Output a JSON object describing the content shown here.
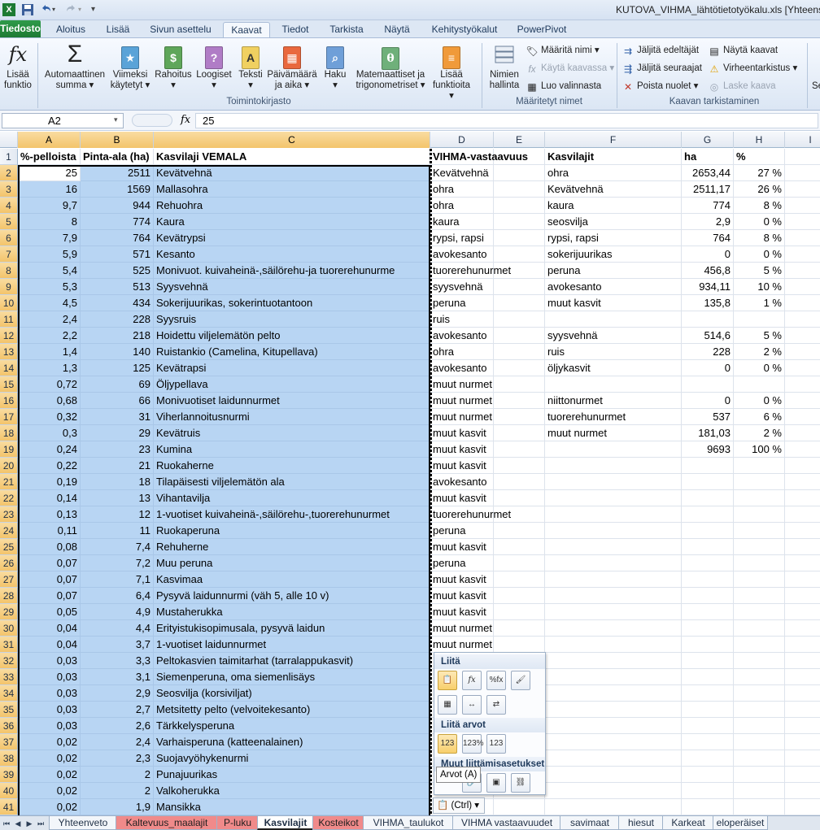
{
  "window": {
    "title": "KUTOVA_VIHMA_lähtötietotyökalu.xls [Yhteens"
  },
  "ribbon_tabs": [
    "Tiedosto",
    "Aloitus",
    "Lisää",
    "Sivun asettelu",
    "Kaavat",
    "Tiedot",
    "Tarkista",
    "Näytä",
    "Kehitystyökalut",
    "PowerPivot"
  ],
  "active_ribbon_tab": "Kaavat",
  "ribbon": {
    "insert_function": [
      "Lisää",
      "funktio"
    ],
    "autosum": [
      "Automaattinen",
      "summa ▾"
    ],
    "recent": [
      "Viimeksi",
      "käytetyt ▾"
    ],
    "financial": [
      "Rahoitus",
      "▾"
    ],
    "logical": [
      "Loogiset",
      "▾"
    ],
    "text": [
      "Teksti",
      "▾"
    ],
    "datetime": [
      "Päivämäärä",
      "ja aika ▾"
    ],
    "lookup": [
      "Haku",
      "▾"
    ],
    "math": [
      "Matemaattiset ja",
      "trigonometriset ▾"
    ],
    "more": [
      "Lisää",
      "funktioita ▾"
    ],
    "library_group": "Toimintokirjasto",
    "name_manager": [
      "Nimien",
      "hallinta"
    ],
    "define_name": "Määritä nimi ▾",
    "use_in_formula": "Käytä kaavassa ▾",
    "create_from_selection": "Luo valinnasta",
    "names_group": "Määritetyt nimet",
    "trace_precedents": "Jäljitä edeltäjät",
    "trace_dependents": "Jäljitä seuraajat",
    "remove_arrows": "Poista nuolet ▾",
    "show_formulas": "Näytä kaavat",
    "error_checking": "Virheentarkistus ▾",
    "evaluate_formula": "Laske kaava",
    "audit_group": "Kaavan tarkistaminen",
    "cut_off": "Se"
  },
  "formula_bar": {
    "name_box": "A2",
    "fx": "fx",
    "value": "25"
  },
  "columns": [
    "A",
    "B",
    "C",
    "D",
    "E",
    "F",
    "G",
    "H",
    "I"
  ],
  "header_row": {
    "a": "%-pelloista",
    "b": "Pinta-ala (ha)",
    "c": "Kasvilaji VEMALA",
    "d": "VIHMA-vastaavuus",
    "f": "Kasvilajit",
    "g": "ha",
    "h": "%"
  },
  "rows": [
    {
      "n": "2",
      "a": "25",
      "b": "2511",
      "c": "Kevätvehnä",
      "d": "Kevätvehnä",
      "f": "ohra",
      "g": "2653,44",
      "h": "27 %"
    },
    {
      "n": "3",
      "a": "16",
      "b": "1569",
      "c": "Mallasohra",
      "d": "ohra",
      "f": "Kevätvehnä",
      "g": "2511,17",
      "h": "26 %"
    },
    {
      "n": "4",
      "a": "9,7",
      "b": "944",
      "c": "Rehuohra",
      "d": "ohra",
      "f": "kaura",
      "g": "774",
      "h": "8 %"
    },
    {
      "n": "5",
      "a": "8",
      "b": "774",
      "c": "Kaura",
      "d": "kaura",
      "f": "seosvilja",
      "g": "2,9",
      "h": "0 %"
    },
    {
      "n": "6",
      "a": "7,9",
      "b": "764",
      "c": "Kevätrypsi",
      "d": "rypsi, rapsi",
      "f": "rypsi, rapsi",
      "g": "764",
      "h": "8 %"
    },
    {
      "n": "7",
      "a": "5,9",
      "b": "571",
      "c": "Kesanto",
      "d": "avokesanto",
      "f": "sokerijuurikas",
      "g": "0",
      "h": "0 %"
    },
    {
      "n": "8",
      "a": "5,4",
      "b": "525",
      "c": "Monivuot. kuivaheinä-,säilörehu-ja tuorerehunurme",
      "d": "tuorerehunurmet",
      "f": "peruna",
      "g": "456,8",
      "h": "5 %"
    },
    {
      "n": "9",
      "a": "5,3",
      "b": "513",
      "c": "Syysvehnä",
      "d": "syysvehnä",
      "f": "avokesanto",
      "g": "934,11",
      "h": "10 %"
    },
    {
      "n": "10",
      "a": "4,5",
      "b": "434",
      "c": "Sokerijuurikas, sokerintuotantoon",
      "d": "peruna",
      "f": "muut kasvit",
      "g": "135,8",
      "h": "1 %"
    },
    {
      "n": "11",
      "a": "2,4",
      "b": "228",
      "c": "Syysruis",
      "d": "ruis",
      "f": "",
      "g": "",
      "h": ""
    },
    {
      "n": "12",
      "a": "2,2",
      "b": "218",
      "c": "Hoidettu viljelemätön pelto",
      "d": "avokesanto",
      "f": "syysvehnä",
      "g": "514,6",
      "h": "5 %"
    },
    {
      "n": "13",
      "a": "1,4",
      "b": "140",
      "c": "Ruistankio (Camelina, Kitupellava)",
      "d": "ohra",
      "f": "ruis",
      "g": "228",
      "h": "2 %"
    },
    {
      "n": "14",
      "a": "1,3",
      "b": "125",
      "c": "Kevätrapsi",
      "d": "avokesanto",
      "f": "öljykasvit",
      "g": "0",
      "h": "0 %"
    },
    {
      "n": "15",
      "a": "0,72",
      "b": "69",
      "c": "Öljypellava",
      "d": "muut nurmet",
      "f": "",
      "g": "",
      "h": ""
    },
    {
      "n": "16",
      "a": "0,68",
      "b": "66",
      "c": "Monivuotiset laidunnurmet",
      "d": "muut nurmet",
      "f": "niittonurmet",
      "g": "0",
      "h": "0 %"
    },
    {
      "n": "17",
      "a": "0,32",
      "b": "31",
      "c": "Viherlannoitusnurmi",
      "d": "muut nurmet",
      "f": "tuorerehunurmet",
      "g": "537",
      "h": "6 %"
    },
    {
      "n": "18",
      "a": "0,3",
      "b": "29",
      "c": "Kevätruis",
      "d": "muut kasvit",
      "f": "muut nurmet",
      "g": "181,03",
      "h": "2 %"
    },
    {
      "n": "19",
      "a": "0,24",
      "b": "23",
      "c": "Kumina",
      "d": "muut kasvit",
      "f": "",
      "g": "9693",
      "h": "100 %"
    },
    {
      "n": "20",
      "a": "0,22",
      "b": "21",
      "c": "Ruokaherne",
      "d": "muut kasvit",
      "f": "",
      "g": "",
      "h": ""
    },
    {
      "n": "21",
      "a": "0,19",
      "b": "18",
      "c": "Tilapäisesti viljelemätön ala",
      "d": "avokesanto",
      "f": "",
      "g": "",
      "h": ""
    },
    {
      "n": "22",
      "a": "0,14",
      "b": "13",
      "c": "Vihantavilja",
      "d": "muut kasvit",
      "f": "",
      "g": "",
      "h": ""
    },
    {
      "n": "23",
      "a": "0,13",
      "b": "12",
      "c": "1-vuotiset kuivaheinä-,säilörehu-,tuorerehunurmet",
      "d": "tuorerehunurmet",
      "f": "",
      "g": "",
      "h": ""
    },
    {
      "n": "24",
      "a": "0,11",
      "b": "11",
      "c": "Ruokaperuna",
      "d": "peruna",
      "f": "",
      "g": "",
      "h": ""
    },
    {
      "n": "25",
      "a": "0,08",
      "b": "7,4",
      "c": "Rehuherne",
      "d": "muut kasvit",
      "f": "",
      "g": "",
      "h": ""
    },
    {
      "n": "26",
      "a": "0,07",
      "b": "7,2",
      "c": "Muu peruna",
      "d": "peruna",
      "f": "",
      "g": "",
      "h": ""
    },
    {
      "n": "27",
      "a": "0,07",
      "b": "7,1",
      "c": "Kasvimaa",
      "d": "muut kasvit",
      "f": "",
      "g": "",
      "h": ""
    },
    {
      "n": "28",
      "a": "0,07",
      "b": "6,4",
      "c": "Pysyvä laidunnurmi (väh 5, alle 10 v)",
      "d": "muut kasvit",
      "f": "",
      "g": "",
      "h": ""
    },
    {
      "n": "29",
      "a": "0,05",
      "b": "4,9",
      "c": "Mustaherukka",
      "d": "muut kasvit",
      "f": "",
      "g": "",
      "h": ""
    },
    {
      "n": "30",
      "a": "0,04",
      "b": "4,4",
      "c": "Erityistukisopimusala, pysyvä laidun",
      "d": "muut nurmet",
      "f": "",
      "g": "",
      "h": ""
    },
    {
      "n": "31",
      "a": "0,04",
      "b": "3,7",
      "c": "1-vuotiset laidunnurmet",
      "d": "muut nurmet",
      "f": "",
      "g": "",
      "h": ""
    },
    {
      "n": "32",
      "a": "0,03",
      "b": "3,3",
      "c": "Peltokasvien taimitarhat (tarralappukasvit)",
      "d": "",
      "f": "",
      "g": "",
      "h": ""
    },
    {
      "n": "33",
      "a": "0,03",
      "b": "3,1",
      "c": "Siemenperuna, oma siemenlisäys",
      "d": "",
      "f": "",
      "g": "",
      "h": ""
    },
    {
      "n": "34",
      "a": "0,03",
      "b": "2,9",
      "c": "Seosvilja (korsiviljat)",
      "d": "",
      "f": "",
      "g": "",
      "h": ""
    },
    {
      "n": "35",
      "a": "0,03",
      "b": "2,7",
      "c": "Metsitetty pelto (velvoitekesanto)",
      "d": "",
      "f": "",
      "g": "",
      "h": ""
    },
    {
      "n": "36",
      "a": "0,03",
      "b": "2,6",
      "c": "Tärkkelysperuna",
      "d": "",
      "f": "",
      "g": "",
      "h": ""
    },
    {
      "n": "37",
      "a": "0,02",
      "b": "2,4",
      "c": "Varhaisperuna (katteenalainen)",
      "d": "",
      "f": "",
      "g": "",
      "h": ""
    },
    {
      "n": "38",
      "a": "0,02",
      "b": "2,3",
      "c": "Suojavyöhykenurmi",
      "d": "",
      "f": "",
      "g": "",
      "h": ""
    },
    {
      "n": "39",
      "a": "0,02",
      "b": "2",
      "c": "Punajuurikas",
      "d": "",
      "f": "",
      "g": "",
      "h": ""
    },
    {
      "n": "40",
      "a": "0,02",
      "b": "2",
      "c": "Valkoherukka",
      "d": "",
      "f": "",
      "g": "",
      "h": ""
    },
    {
      "n": "41",
      "a": "0,02",
      "b": "1,9",
      "c": "Mansikka",
      "d": "",
      "f": "",
      "g": "",
      "h": ""
    }
  ],
  "paste_options": {
    "paste_title": "Liitä",
    "values_title": "Liitä arvot",
    "other_title": "Muut liittämisasetukset",
    "tooltip": "Arvot (A)",
    "ctrl_label": "(Ctrl) ▾"
  },
  "sheet_tabs": [
    {
      "label": "Yhteenveto",
      "style": "normal"
    },
    {
      "label": "Kaltevuus_maalajit",
      "style": "red"
    },
    {
      "label": "P-luku",
      "style": "red"
    },
    {
      "label": "Kasvilajit",
      "style": "active"
    },
    {
      "label": "Kosteikot",
      "style": "red"
    },
    {
      "label": "VIHMA_taulukot",
      "style": "normal"
    },
    {
      "label": "VIHMA vastaavuudet",
      "style": "normal"
    },
    {
      "label": "savimaat",
      "style": "normal"
    },
    {
      "label": "hiesut",
      "style": "normal"
    },
    {
      "label": "Karkeat",
      "style": "normal"
    },
    {
      "label": "eloperäiset",
      "style": "normal"
    }
  ],
  "colors": {
    "selection": "#b8d5f3",
    "file_tab": "#1d7a33",
    "red_tab": "#f08a8a",
    "header_highlight": "#f3c46b"
  }
}
